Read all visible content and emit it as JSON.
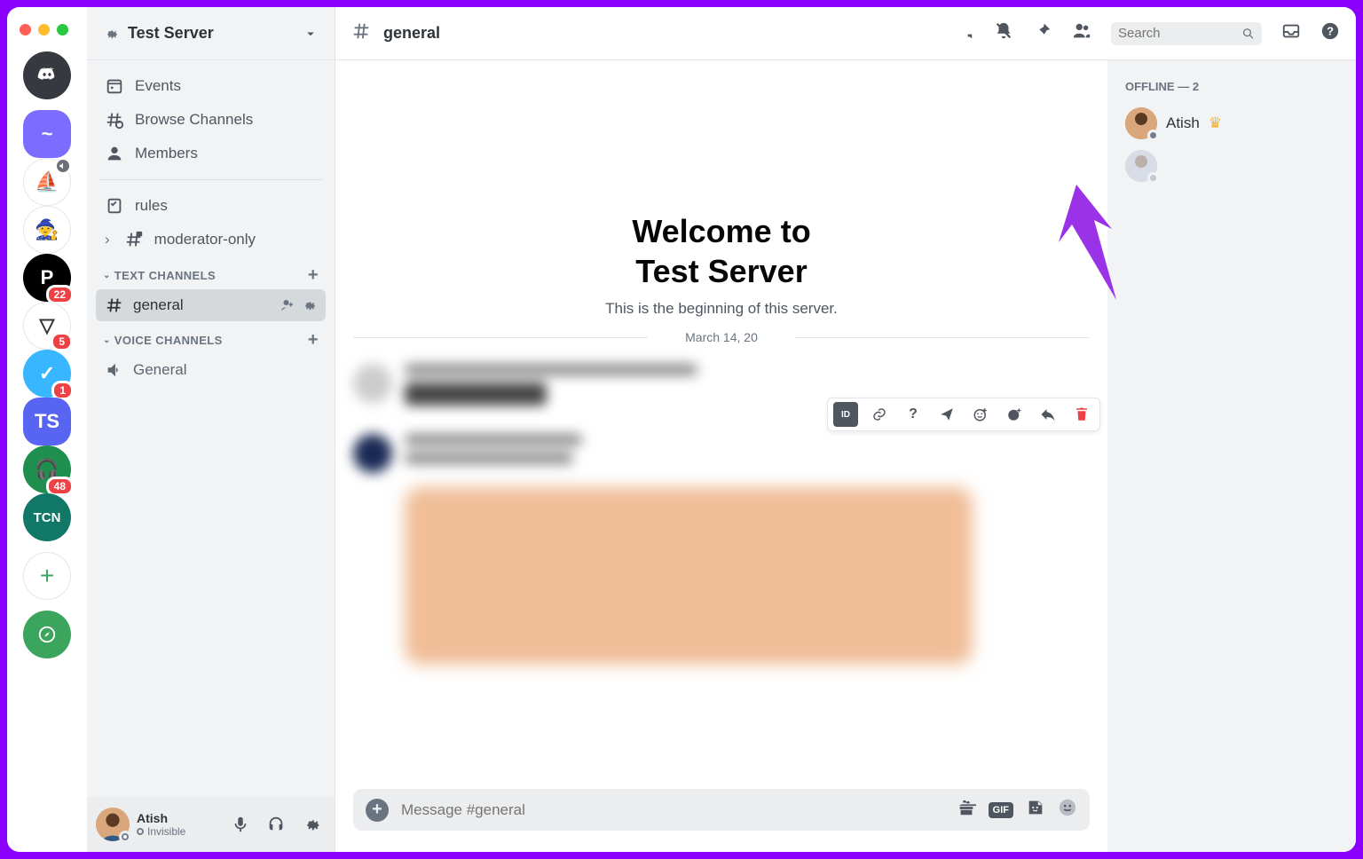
{
  "server_header": {
    "name": "Test Server",
    "boost_icon": "gear-boost"
  },
  "sidebar": {
    "links": [
      {
        "icon": "events",
        "label": "Events"
      },
      {
        "icon": "browse",
        "label": "Browse Channels"
      },
      {
        "icon": "members",
        "label": "Members"
      }
    ],
    "pinned_channels": [
      {
        "icon": "rules",
        "label": "rules"
      },
      {
        "icon": "lock-hash",
        "label": "moderator-only",
        "has_pin": true
      }
    ],
    "categories": [
      {
        "name": "TEXT CHANNELS",
        "channels": [
          {
            "icon": "hash",
            "label": "general",
            "selected": true
          }
        ]
      },
      {
        "name": "VOICE CHANNELS",
        "channels": [
          {
            "icon": "speaker",
            "label": "General"
          }
        ]
      }
    ]
  },
  "servers_rail": {
    "home": "discord",
    "items": [
      {
        "bg": "#7c6cff",
        "label": "~",
        "selected": true
      },
      {
        "bg": "#ffffff",
        "label": "⛵",
        "voice": true
      },
      {
        "bg": "#ffffff",
        "label": "🧙"
      },
      {
        "bg": "#000000",
        "label": "P",
        "badge": "22"
      },
      {
        "bg": "#ffffff",
        "label": "▽",
        "badge": "5"
      },
      {
        "bg": "#38b6ff",
        "label": "✓",
        "badge": "1"
      },
      {
        "bg": "#5865f2",
        "label": "TS",
        "rounded": true
      },
      {
        "bg": "#1e8f4e",
        "label": "🎧",
        "badge": "48"
      },
      {
        "bg": "#117766",
        "label": "TCN"
      }
    ],
    "add_label": "+"
  },
  "user_panel": {
    "name": "Atish",
    "status": "Invisible"
  },
  "chat": {
    "channel_name": "general",
    "search_placeholder": "Search",
    "welcome_title_1": "Welcome to",
    "welcome_title_2": "Test Server",
    "welcome_sub": "This is the beginning of this server.",
    "date_divider": "March 14, 20",
    "composer_placeholder": "Message #general"
  },
  "message_actions": [
    "ID",
    "link",
    "help",
    "send",
    "react-add",
    "sticker-add",
    "reply",
    "delete"
  ],
  "members": {
    "offline_header": "OFFLINE — 2",
    "list": [
      {
        "name": "Atish",
        "crown": true
      },
      {
        "name": "",
        "dim": true
      }
    ]
  },
  "colors": {
    "accent_arrow": "#9a33e8"
  }
}
